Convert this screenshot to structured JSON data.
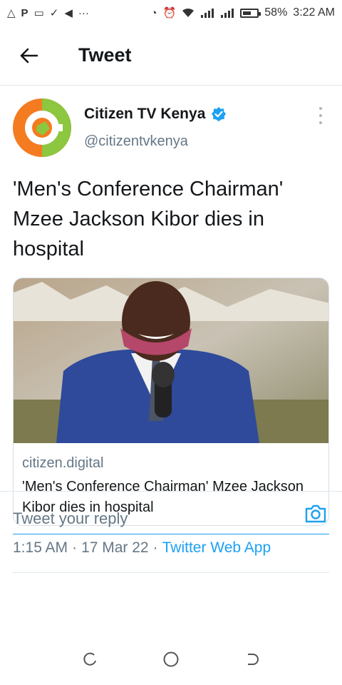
{
  "status_bar": {
    "battery": "58%",
    "battery_level": 0.58,
    "time": "3:22 AM",
    "left_icons": [
      "warning-icon",
      "parking-icon",
      "message-icon",
      "check-icon",
      "telegram-icon",
      "more-icon"
    ],
    "right_icons": [
      "data-saver-icon",
      "alarm-icon",
      "wifi-icon",
      "signal-icon",
      "signal-icon",
      "battery-icon"
    ]
  },
  "header": {
    "title": "Tweet",
    "back_icon": "arrow-left-icon"
  },
  "tweet": {
    "author_name": "Citizen TV Kenya",
    "handle": "@citizentvkenya",
    "verified": true,
    "text": "'Men's Conference Chairman' Mzee Jackson Kibor dies in hospital",
    "card": {
      "domain": "citizen.digital",
      "title": "'Men's Conference Chairman' Mzee Jackson Kibor dies in hospital"
    },
    "time": "1:15 AM",
    "date": "17 Mar 22",
    "source": "Twitter Web App",
    "separator": "·"
  },
  "reply": {
    "placeholder": "Tweet your reply",
    "camera_icon": "camera-icon"
  },
  "colors": {
    "accent": "#1da1f2",
    "secondary_text": "#657786",
    "avatar_orange": "#f47b20",
    "avatar_green": "#8dc63f"
  }
}
